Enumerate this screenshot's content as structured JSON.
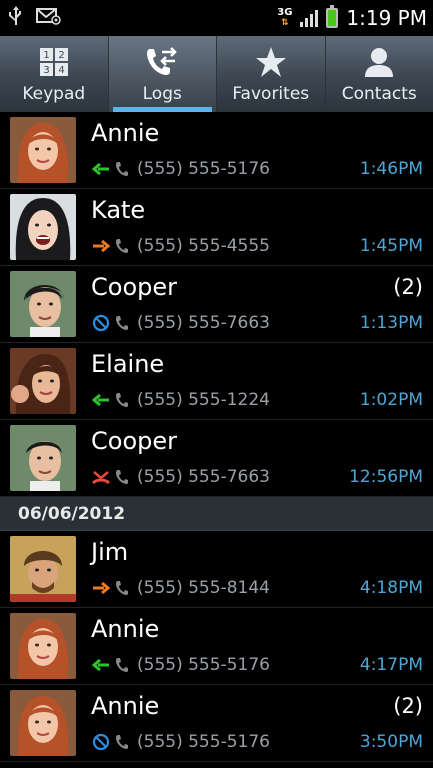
{
  "status": {
    "time": "1:19 PM",
    "network": "3G",
    "left_icons": [
      "usb-icon",
      "voicemail-notification-icon"
    ]
  },
  "tabs": [
    {
      "label": "Keypad",
      "icon": "keypad-icon",
      "active": false
    },
    {
      "label": "Logs",
      "icon": "call-logs-icon",
      "active": true
    },
    {
      "label": "Favorites",
      "icon": "star-icon",
      "active": false
    },
    {
      "label": "Contacts",
      "icon": "person-icon",
      "active": false
    }
  ],
  "logs_today": [
    {
      "name": "Annie",
      "number": "(555) 555-5176",
      "time": "1:46PM",
      "count": "",
      "type": "incoming"
    },
    {
      "name": "Kate",
      "number": "(555) 555-4555",
      "time": "1:45PM",
      "count": "",
      "type": "outgoing"
    },
    {
      "name": "Cooper",
      "number": "(555) 555-7663",
      "time": "1:13PM",
      "count": "(2)",
      "type": "rejected"
    },
    {
      "name": "Elaine",
      "number": "(555) 555-1224",
      "time": "1:02PM",
      "count": "",
      "type": "incoming"
    },
    {
      "name": "Cooper",
      "number": "(555) 555-7663",
      "time": "12:56PM",
      "count": "",
      "type": "missed"
    }
  ],
  "date_header": "06/06/2012",
  "logs_previous": [
    {
      "name": "Jim",
      "number": "(555) 555-8144",
      "time": "4:18PM",
      "count": "",
      "type": "outgoing"
    },
    {
      "name": "Annie",
      "number": "(555) 555-5176",
      "time": "4:17PM",
      "count": "",
      "type": "incoming"
    },
    {
      "name": "Annie",
      "number": "(555) 555-5176",
      "time": "3:50PM",
      "count": "(2)",
      "type": "rejected"
    }
  ],
  "colors": {
    "incoming": "#2ec32e",
    "outgoing": "#f07a1c",
    "rejected": "#2b8fe0",
    "missed": "#e84a3a",
    "time": "#4da6d8",
    "tab_indicator": "#59b5ee"
  }
}
